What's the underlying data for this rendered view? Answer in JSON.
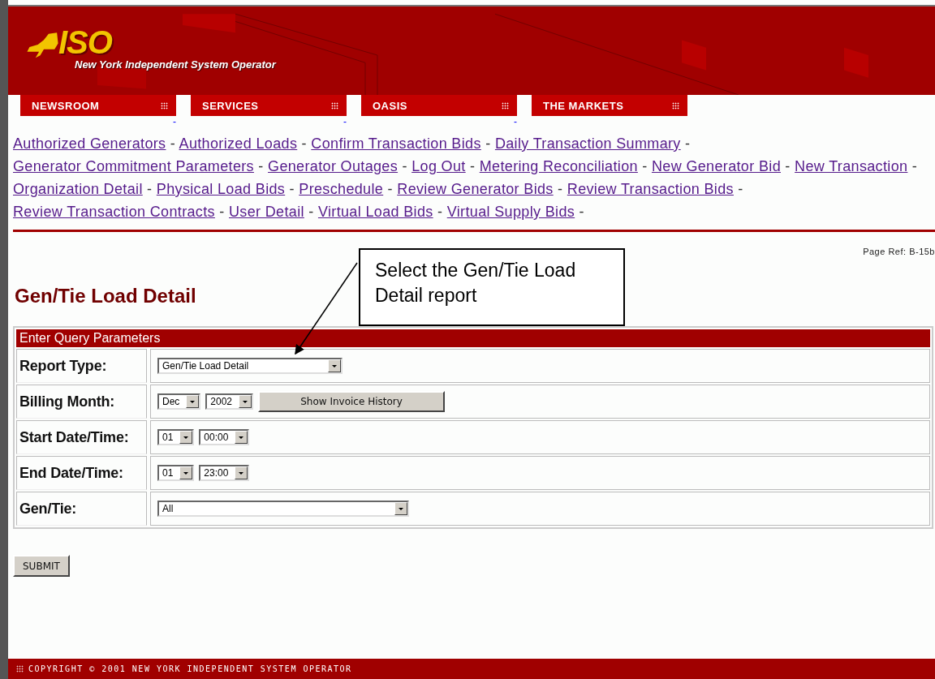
{
  "header": {
    "logo": "ISO",
    "subtitle": "New York Independent System Operator"
  },
  "tabs": [
    {
      "label": "NEWSROOM",
      "marker": "-"
    },
    {
      "label": "SERVICES",
      "marker": "-"
    },
    {
      "label": "OASIS",
      "marker": "-"
    },
    {
      "label": "THE MARKETS"
    }
  ],
  "nav_links": {
    "separator": "-",
    "items": [
      "Authorized Generators",
      "Authorized Loads",
      "Confirm Transaction Bids",
      "Daily Transaction Summary",
      "Generator Commitment Parameters",
      "Generator Outages",
      "Log Out",
      "Metering Reconciliation",
      "New Generator Bid",
      "New Transaction",
      "Organization Detail",
      "Physical Load Bids",
      "Preschedule",
      "Review Generator Bids",
      "Review Transaction Bids",
      "Review Transaction Contracts",
      "User Detail",
      "Virtual Load Bids",
      "Virtual Supply Bids"
    ]
  },
  "page_ref": "Page Ref: B-15b",
  "callout": "Select the Gen/Tie Load Detail report",
  "page_title": "Gen/Tie Load Detail",
  "form": {
    "title": "Enter Query Parameters",
    "rows": [
      {
        "label": "Report Type:",
        "controls": [
          {
            "kind": "select",
            "value": "Gen/Tie Load Detail"
          }
        ]
      },
      {
        "label": "Billing Month:",
        "controls": [
          {
            "kind": "select",
            "value": "Dec"
          },
          {
            "kind": "select",
            "value": "2002"
          },
          {
            "kind": "button",
            "label": "Show Invoice History"
          }
        ]
      },
      {
        "label": "Start Date/Time:",
        "controls": [
          {
            "kind": "select",
            "value": "01"
          },
          {
            "kind": "select",
            "value": "00:00"
          }
        ]
      },
      {
        "label": "End Date/Time:",
        "controls": [
          {
            "kind": "select",
            "value": "01"
          },
          {
            "kind": "select",
            "value": "23:00"
          }
        ]
      },
      {
        "label": "Gen/Tie:",
        "controls": [
          {
            "kind": "select",
            "value": "All"
          }
        ]
      }
    ]
  },
  "submit": "SUBMIT",
  "footer": "COPYRIGHT © 2001 NEW YORK INDEPENDENT SYSTEM OPERATOR"
}
